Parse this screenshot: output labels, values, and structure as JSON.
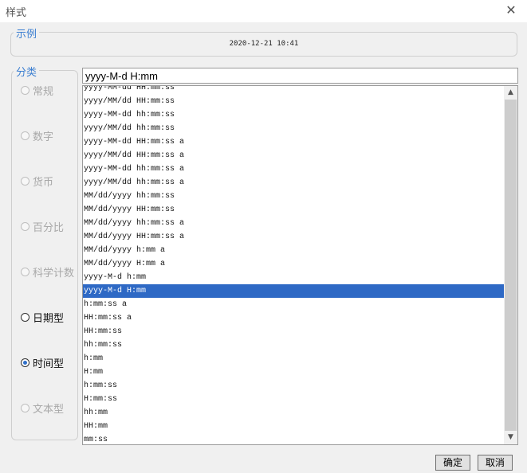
{
  "window": {
    "title": "样式"
  },
  "example": {
    "legend": "示例",
    "value": "2020-12-21 10:41"
  },
  "category": {
    "legend": "分类",
    "options": [
      {
        "label": "常规",
        "enabled": false,
        "selected": false
      },
      {
        "label": "数字",
        "enabled": false,
        "selected": false
      },
      {
        "label": "货币",
        "enabled": false,
        "selected": false
      },
      {
        "label": "百分比",
        "enabled": false,
        "selected": false
      },
      {
        "label": "科学计数",
        "enabled": false,
        "selected": false
      },
      {
        "label": "日期型",
        "enabled": true,
        "selected": false
      },
      {
        "label": "时间型",
        "enabled": true,
        "selected": true
      },
      {
        "label": "文本型",
        "enabled": false,
        "selected": false
      }
    ]
  },
  "format": {
    "value": "yyyy-M-d H:mm",
    "items": [
      "yyyy-MM-dd HH:mm:ss",
      "yyyy/MM/dd HH:mm:ss",
      "yyyy-MM-dd hh:mm:ss",
      "yyyy/MM/dd hh:mm:ss",
      "yyyy-MM-dd HH:mm:ss a",
      "yyyy/MM/dd HH:mm:ss a",
      "yyyy-MM-dd hh:mm:ss a",
      "yyyy/MM/dd hh:mm:ss a",
      "MM/dd/yyyy hh:mm:ss",
      "MM/dd/yyyy HH:mm:ss",
      "MM/dd/yyyy hh:mm:ss a",
      "MM/dd/yyyy HH:mm:ss a",
      "MM/dd/yyyy h:mm a",
      "MM/dd/yyyy H:mm a",
      "yyyy-M-d h:mm",
      "yyyy-M-d H:mm",
      "h:mm:ss a",
      "HH:mm:ss a",
      "HH:mm:ss",
      "hh:mm:ss",
      "h:mm",
      "H:mm",
      "h:mm:ss",
      "H:mm:ss",
      "hh:mm",
      "HH:mm",
      "mm:ss"
    ],
    "selected_index": 15
  },
  "scroll": {
    "up": "▲",
    "down": "▼"
  },
  "buttons": {
    "ok": "确定",
    "cancel": "取消"
  },
  "colors": {
    "accent": "#2e69c5",
    "legend": "#3c7fd1"
  }
}
